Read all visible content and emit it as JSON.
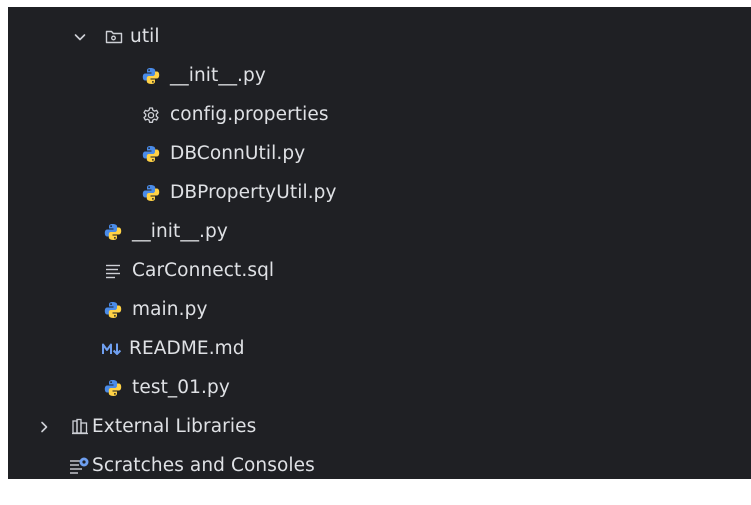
{
  "tree": {
    "util_folder": {
      "label": "util",
      "expanded": true,
      "icon": "folder-package-icon"
    },
    "util_children": [
      {
        "label": "__init__.py",
        "icon": "python-icon"
      },
      {
        "label": "config.properties",
        "icon": "gear-icon"
      },
      {
        "label": "DBConnUtil.py",
        "icon": "python-icon"
      },
      {
        "label": "DBPropertyUtil.py",
        "icon": "python-icon"
      }
    ],
    "root_files": [
      {
        "label": "__init__.py",
        "icon": "python-icon"
      },
      {
        "label": "CarConnect.sql",
        "icon": "sql-file-icon"
      },
      {
        "label": "main.py",
        "icon": "python-icon"
      },
      {
        "label": "README.md",
        "icon": "markdown-icon"
      },
      {
        "label": "test_01.py",
        "icon": "python-icon"
      }
    ],
    "external_libraries": {
      "label": "External Libraries",
      "expanded": false,
      "icon": "library-icon"
    },
    "scratches": {
      "label": "Scratches and Consoles",
      "icon": "scratches-icon"
    }
  },
  "colors": {
    "background": "#1f2024",
    "text": "#dfe1e5",
    "python_blue": "#4a8be8",
    "python_yellow": "#ffd246",
    "icon_gray": "#ced0d6",
    "badge_blue": "#6f9ff0"
  }
}
